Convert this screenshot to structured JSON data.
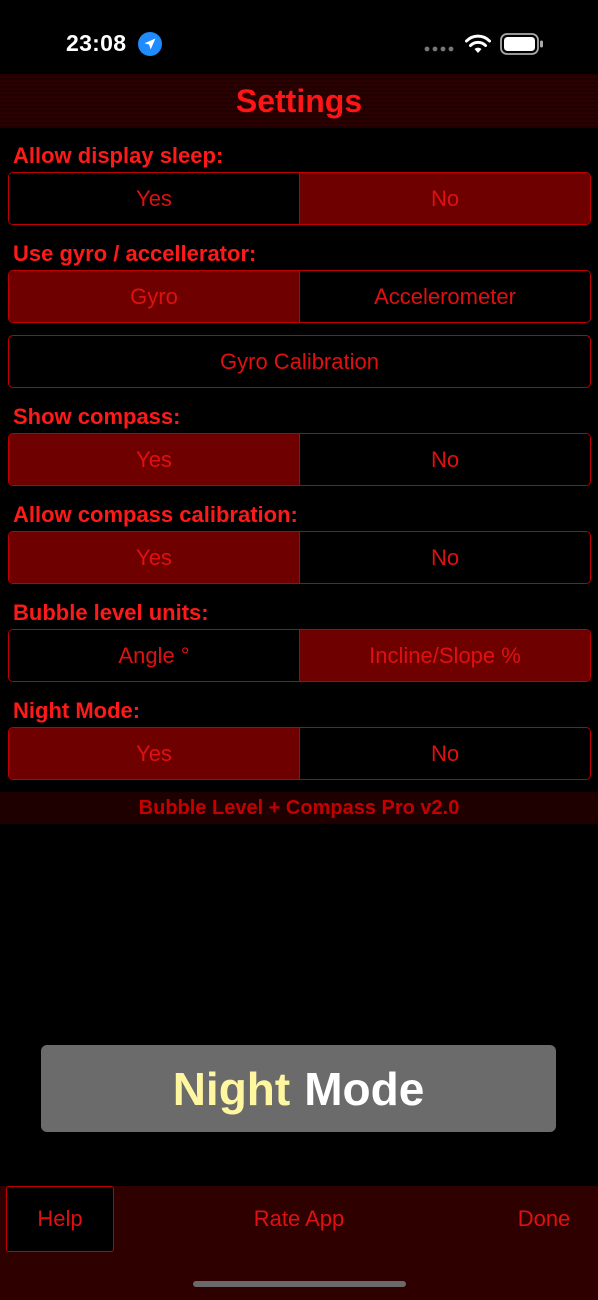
{
  "status_bar": {
    "time": "23:08",
    "icons": [
      "location-arrow-icon",
      "signal-icon",
      "wifi-icon",
      "battery-icon"
    ]
  },
  "header": {
    "title": "Settings"
  },
  "sections": [
    {
      "label": "Allow display sleep:",
      "options": [
        "Yes",
        "No"
      ],
      "selected": 1
    },
    {
      "label": "Use gyro / accellerator:",
      "options": [
        "Gyro",
        "Accelerometer"
      ],
      "selected": 0
    },
    {
      "button": "Gyro Calibration"
    },
    {
      "label": "Show compass:",
      "options": [
        "Yes",
        "No"
      ],
      "selected": 0
    },
    {
      "label": "Allow compass calibration:",
      "options": [
        "Yes",
        "No"
      ],
      "selected": 0
    },
    {
      "label": "Bubble level units:",
      "options": [
        "Angle °",
        "Incline/Slope %"
      ],
      "selected": 1
    },
    {
      "label": "Night Mode:",
      "options": [
        "Yes",
        "No"
      ],
      "selected": 0
    }
  ],
  "version": "Bubble Level + Compass Pro v2.0",
  "toast": {
    "word1": "Night",
    "word2": "Mode"
  },
  "bottom_bar": {
    "help": "Help",
    "rate": "Rate App",
    "done": "Done"
  },
  "colors": {
    "accent": "#e01010",
    "selected_bg": "#6e0000",
    "toast_bg": "#6b6b6b",
    "toast_highlight": "#fff7a0"
  }
}
